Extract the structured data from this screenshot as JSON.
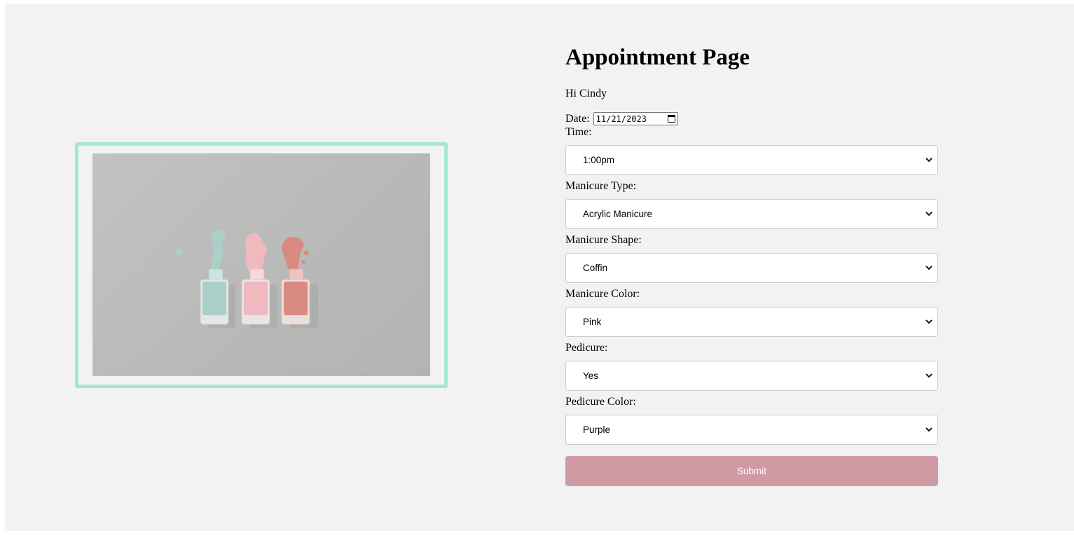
{
  "page": {
    "title": "Appointment Page",
    "greeting": "Hi Cindy"
  },
  "colors": {
    "background": "#f2f2f2",
    "image_frame": "#a3e8d4",
    "submit": "#cf9aa3"
  },
  "form": {
    "date_label": "Date:",
    "date_value": "11/21/2023",
    "time": {
      "label": "Time:",
      "value": "1:00pm"
    },
    "manicure_type": {
      "label": "Manicure Type:",
      "value": "Acrylic Manicure"
    },
    "manicure_shape": {
      "label": "Manicure Shape:",
      "value": "Coffin"
    },
    "manicure_color": {
      "label": "Manicure Color:",
      "value": "Pink"
    },
    "pedicure": {
      "label": "Pedicure:",
      "value": "Yes"
    },
    "pedicure_color": {
      "label": "Pedicure Color:",
      "value": "Purple"
    },
    "submit_label": "Submit"
  },
  "image": {
    "icons": [
      "calendar-icon",
      "chevron-down-icon"
    ]
  }
}
